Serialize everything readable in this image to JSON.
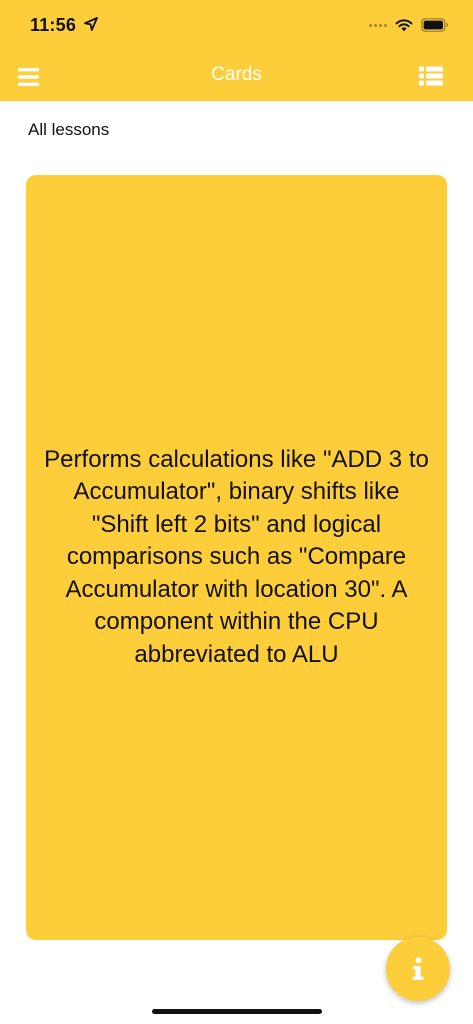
{
  "status_bar": {
    "time": "11:56"
  },
  "nav": {
    "title": "Cards"
  },
  "lesson": {
    "label": "All lessons"
  },
  "card": {
    "text": "Performs calculations like \"ADD 3 to Accumulator\", binary shifts like \"Shift left 2 bits\" and logical comparisons such as \"Compare Accumulator with location 30\". A component within the CPU abbreviated to ALU"
  },
  "icons": {
    "menu": "hamburger-menu-icon",
    "list": "list-view-icon",
    "info": "info-icon",
    "location": "location-arrow-icon",
    "wifi": "wifi-icon",
    "battery": "battery-icon"
  },
  "colors": {
    "accent": "#fdcd3a",
    "title_text": "#ffffff",
    "body_text": "#111111"
  }
}
